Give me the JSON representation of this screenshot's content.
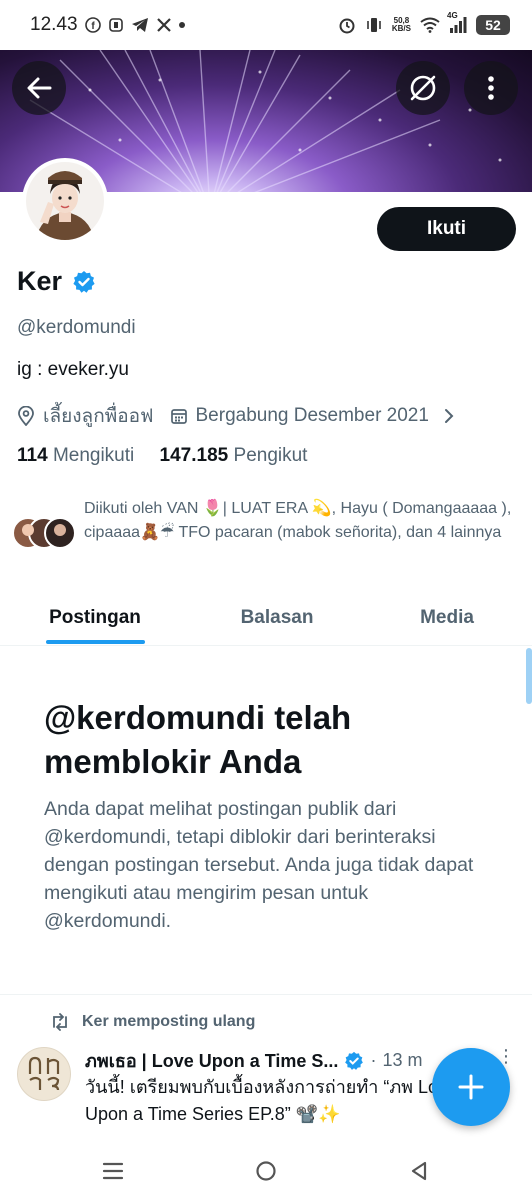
{
  "status_bar": {
    "time": "12.43",
    "net_speed_value": "50,8",
    "net_speed_unit": "KB/S",
    "network_type": "4G",
    "battery": "52"
  },
  "header": {
    "back_icon": "arrow-left-icon",
    "block_icon": "no-entry-icon",
    "more_icon": "vertical-dots-icon"
  },
  "profile": {
    "name": "Ker",
    "verified": true,
    "handle": "@kerdomundi",
    "bio": "ig : eveker.yu",
    "location": "เลี้ยงลูกพื่ออฟ",
    "joined": "Bergabung Desember 2021",
    "following_count": "114",
    "following_label": "Mengikuti",
    "followers_count": "147.185",
    "followers_label": "Pengikut",
    "follow_button": "Ikuti",
    "followed_by": "Diikuti oleh VAN 🌷| LUAT ERA 💫, Hayu ( Domangaaaaa ), cipaaaa🧸☔ TFO pacaran (mabok señorita), dan 4 lainnya"
  },
  "tabs": [
    {
      "label": "Postingan",
      "active": true
    },
    {
      "label": "Balasan",
      "active": false
    },
    {
      "label": "Media",
      "active": false
    }
  ],
  "blocked": {
    "title": "@kerdomundi telah memblokir Anda",
    "body": "Anda dapat melihat postingan publik dari @kerdomundi, tetapi diblokir dari berinteraksi dengan postingan tersebut. Anda juga tidak dapat mengikuti atau mengirim pesan untuk @kerdomundi."
  },
  "post": {
    "repost_label": "Ker memposting ulang",
    "author": "ภพเธอ | Love Upon a Time S...",
    "separator": "·",
    "time": "13 m",
    "more": "⋮",
    "text": "วันนี้! เตรียมพบกับเบื้องหลังการถ่ายทำ “ภพ Love Upon a Time Series EP.8” 📽️✨"
  },
  "colors": {
    "accent": "#1d9bf0",
    "text_primary": "#0f1419",
    "text_secondary": "#536471",
    "follow_button_bg": "#0f1419"
  }
}
